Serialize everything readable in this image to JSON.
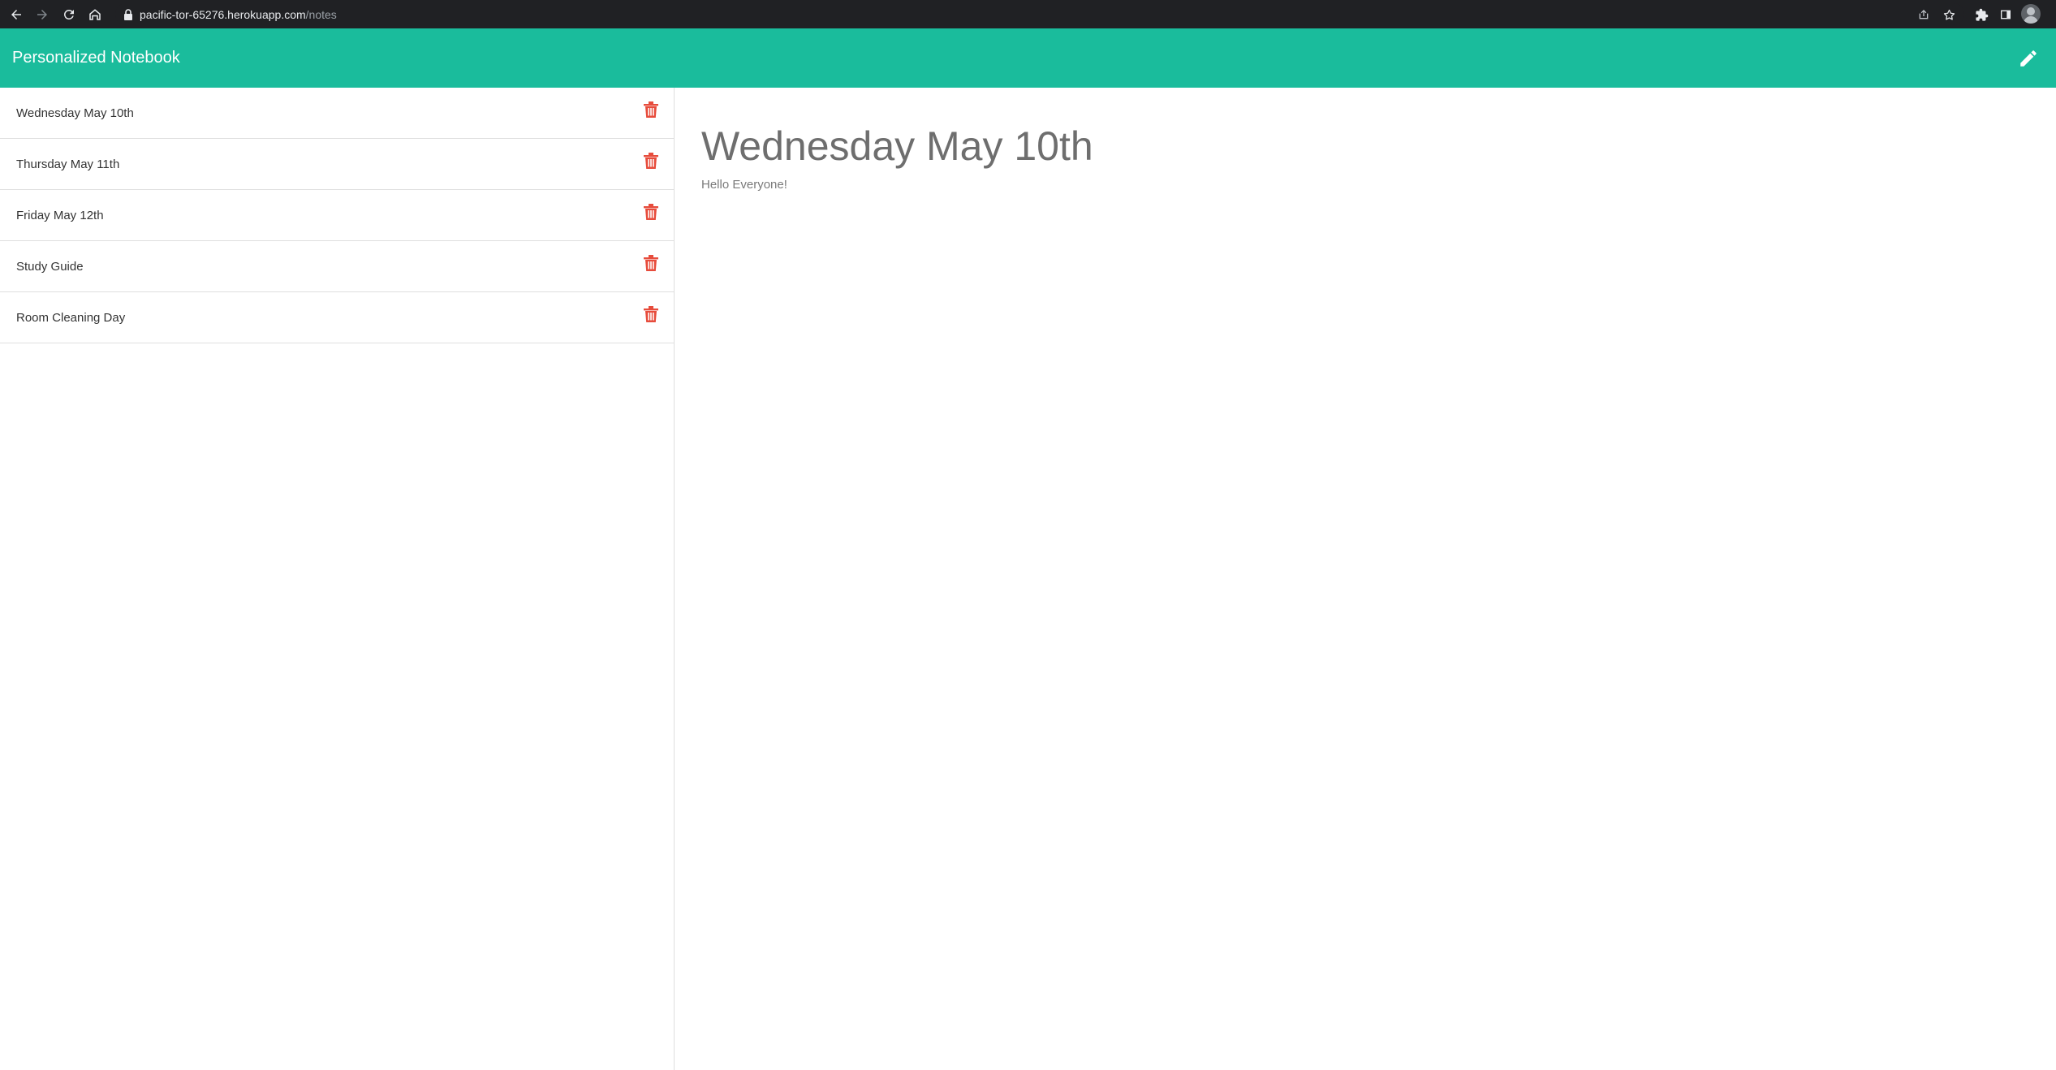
{
  "browser": {
    "url_host": "pacific-tor-65276.herokuapp.com",
    "url_path": "/notes"
  },
  "header": {
    "title": "Personalized Notebook",
    "background": "#1abc9c",
    "edit_icon": "pencil-icon"
  },
  "sidebar": {
    "delete_icon": "trash-icon",
    "delete_color": "#e74c3c",
    "notes": [
      {
        "title": "Wednesday May 10th"
      },
      {
        "title": "Thursday May 11th"
      },
      {
        "title": "Friday May 12th"
      },
      {
        "title": "Study Guide"
      },
      {
        "title": "Room Cleaning Day"
      }
    ]
  },
  "active_note": {
    "title": "Wednesday May 10th",
    "text": "Hello Everyone!"
  }
}
